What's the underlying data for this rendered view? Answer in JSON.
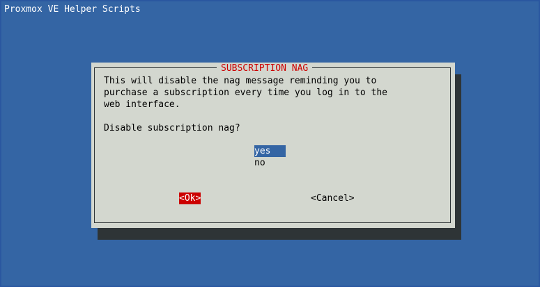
{
  "backtitle": "Proxmox VE Helper Scripts",
  "dialog": {
    "title": "SUBSCRIPTION NAG",
    "message": "This will disable the nag message reminding you to\npurchase a subscription every time you log in to the\nweb interface.",
    "question": "Disable subscription nag?",
    "options": [
      {
        "label": "yes",
        "selected": true
      },
      {
        "label": "no",
        "selected": false
      }
    ],
    "buttons": {
      "ok_label": "<Ok>",
      "cancel_label": "<Cancel>"
    }
  },
  "colors": {
    "background": "#3465a4",
    "dialog_bg": "#d3d7cf",
    "shadow": "#2e3436",
    "title_red": "#cc0000",
    "selection_blue": "#3465a4",
    "focus_red": "#cc0000"
  }
}
